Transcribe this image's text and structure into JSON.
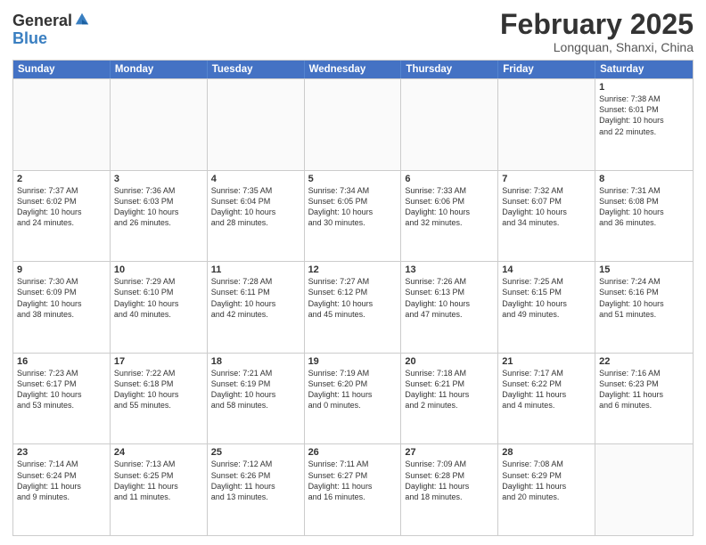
{
  "header": {
    "logo_general": "General",
    "logo_blue": "Blue",
    "month_year": "February 2025",
    "location": "Longquan, Shanxi, China"
  },
  "weekdays": [
    "Sunday",
    "Monday",
    "Tuesday",
    "Wednesday",
    "Thursday",
    "Friday",
    "Saturday"
  ],
  "weeks": [
    [
      {
        "day": "",
        "info": ""
      },
      {
        "day": "",
        "info": ""
      },
      {
        "day": "",
        "info": ""
      },
      {
        "day": "",
        "info": ""
      },
      {
        "day": "",
        "info": ""
      },
      {
        "day": "",
        "info": ""
      },
      {
        "day": "1",
        "info": "Sunrise: 7:38 AM\nSunset: 6:01 PM\nDaylight: 10 hours\nand 22 minutes."
      }
    ],
    [
      {
        "day": "2",
        "info": "Sunrise: 7:37 AM\nSunset: 6:02 PM\nDaylight: 10 hours\nand 24 minutes."
      },
      {
        "day": "3",
        "info": "Sunrise: 7:36 AM\nSunset: 6:03 PM\nDaylight: 10 hours\nand 26 minutes."
      },
      {
        "day": "4",
        "info": "Sunrise: 7:35 AM\nSunset: 6:04 PM\nDaylight: 10 hours\nand 28 minutes."
      },
      {
        "day": "5",
        "info": "Sunrise: 7:34 AM\nSunset: 6:05 PM\nDaylight: 10 hours\nand 30 minutes."
      },
      {
        "day": "6",
        "info": "Sunrise: 7:33 AM\nSunset: 6:06 PM\nDaylight: 10 hours\nand 32 minutes."
      },
      {
        "day": "7",
        "info": "Sunrise: 7:32 AM\nSunset: 6:07 PM\nDaylight: 10 hours\nand 34 minutes."
      },
      {
        "day": "8",
        "info": "Sunrise: 7:31 AM\nSunset: 6:08 PM\nDaylight: 10 hours\nand 36 minutes."
      }
    ],
    [
      {
        "day": "9",
        "info": "Sunrise: 7:30 AM\nSunset: 6:09 PM\nDaylight: 10 hours\nand 38 minutes."
      },
      {
        "day": "10",
        "info": "Sunrise: 7:29 AM\nSunset: 6:10 PM\nDaylight: 10 hours\nand 40 minutes."
      },
      {
        "day": "11",
        "info": "Sunrise: 7:28 AM\nSunset: 6:11 PM\nDaylight: 10 hours\nand 42 minutes."
      },
      {
        "day": "12",
        "info": "Sunrise: 7:27 AM\nSunset: 6:12 PM\nDaylight: 10 hours\nand 45 minutes."
      },
      {
        "day": "13",
        "info": "Sunrise: 7:26 AM\nSunset: 6:13 PM\nDaylight: 10 hours\nand 47 minutes."
      },
      {
        "day": "14",
        "info": "Sunrise: 7:25 AM\nSunset: 6:15 PM\nDaylight: 10 hours\nand 49 minutes."
      },
      {
        "day": "15",
        "info": "Sunrise: 7:24 AM\nSunset: 6:16 PM\nDaylight: 10 hours\nand 51 minutes."
      }
    ],
    [
      {
        "day": "16",
        "info": "Sunrise: 7:23 AM\nSunset: 6:17 PM\nDaylight: 10 hours\nand 53 minutes."
      },
      {
        "day": "17",
        "info": "Sunrise: 7:22 AM\nSunset: 6:18 PM\nDaylight: 10 hours\nand 55 minutes."
      },
      {
        "day": "18",
        "info": "Sunrise: 7:21 AM\nSunset: 6:19 PM\nDaylight: 10 hours\nand 58 minutes."
      },
      {
        "day": "19",
        "info": "Sunrise: 7:19 AM\nSunset: 6:20 PM\nDaylight: 11 hours\nand 0 minutes."
      },
      {
        "day": "20",
        "info": "Sunrise: 7:18 AM\nSunset: 6:21 PM\nDaylight: 11 hours\nand 2 minutes."
      },
      {
        "day": "21",
        "info": "Sunrise: 7:17 AM\nSunset: 6:22 PM\nDaylight: 11 hours\nand 4 minutes."
      },
      {
        "day": "22",
        "info": "Sunrise: 7:16 AM\nSunset: 6:23 PM\nDaylight: 11 hours\nand 6 minutes."
      }
    ],
    [
      {
        "day": "23",
        "info": "Sunrise: 7:14 AM\nSunset: 6:24 PM\nDaylight: 11 hours\nand 9 minutes."
      },
      {
        "day": "24",
        "info": "Sunrise: 7:13 AM\nSunset: 6:25 PM\nDaylight: 11 hours\nand 11 minutes."
      },
      {
        "day": "25",
        "info": "Sunrise: 7:12 AM\nSunset: 6:26 PM\nDaylight: 11 hours\nand 13 minutes."
      },
      {
        "day": "26",
        "info": "Sunrise: 7:11 AM\nSunset: 6:27 PM\nDaylight: 11 hours\nand 16 minutes."
      },
      {
        "day": "27",
        "info": "Sunrise: 7:09 AM\nSunset: 6:28 PM\nDaylight: 11 hours\nand 18 minutes."
      },
      {
        "day": "28",
        "info": "Sunrise: 7:08 AM\nSunset: 6:29 PM\nDaylight: 11 hours\nand 20 minutes."
      },
      {
        "day": "",
        "info": ""
      }
    ]
  ]
}
